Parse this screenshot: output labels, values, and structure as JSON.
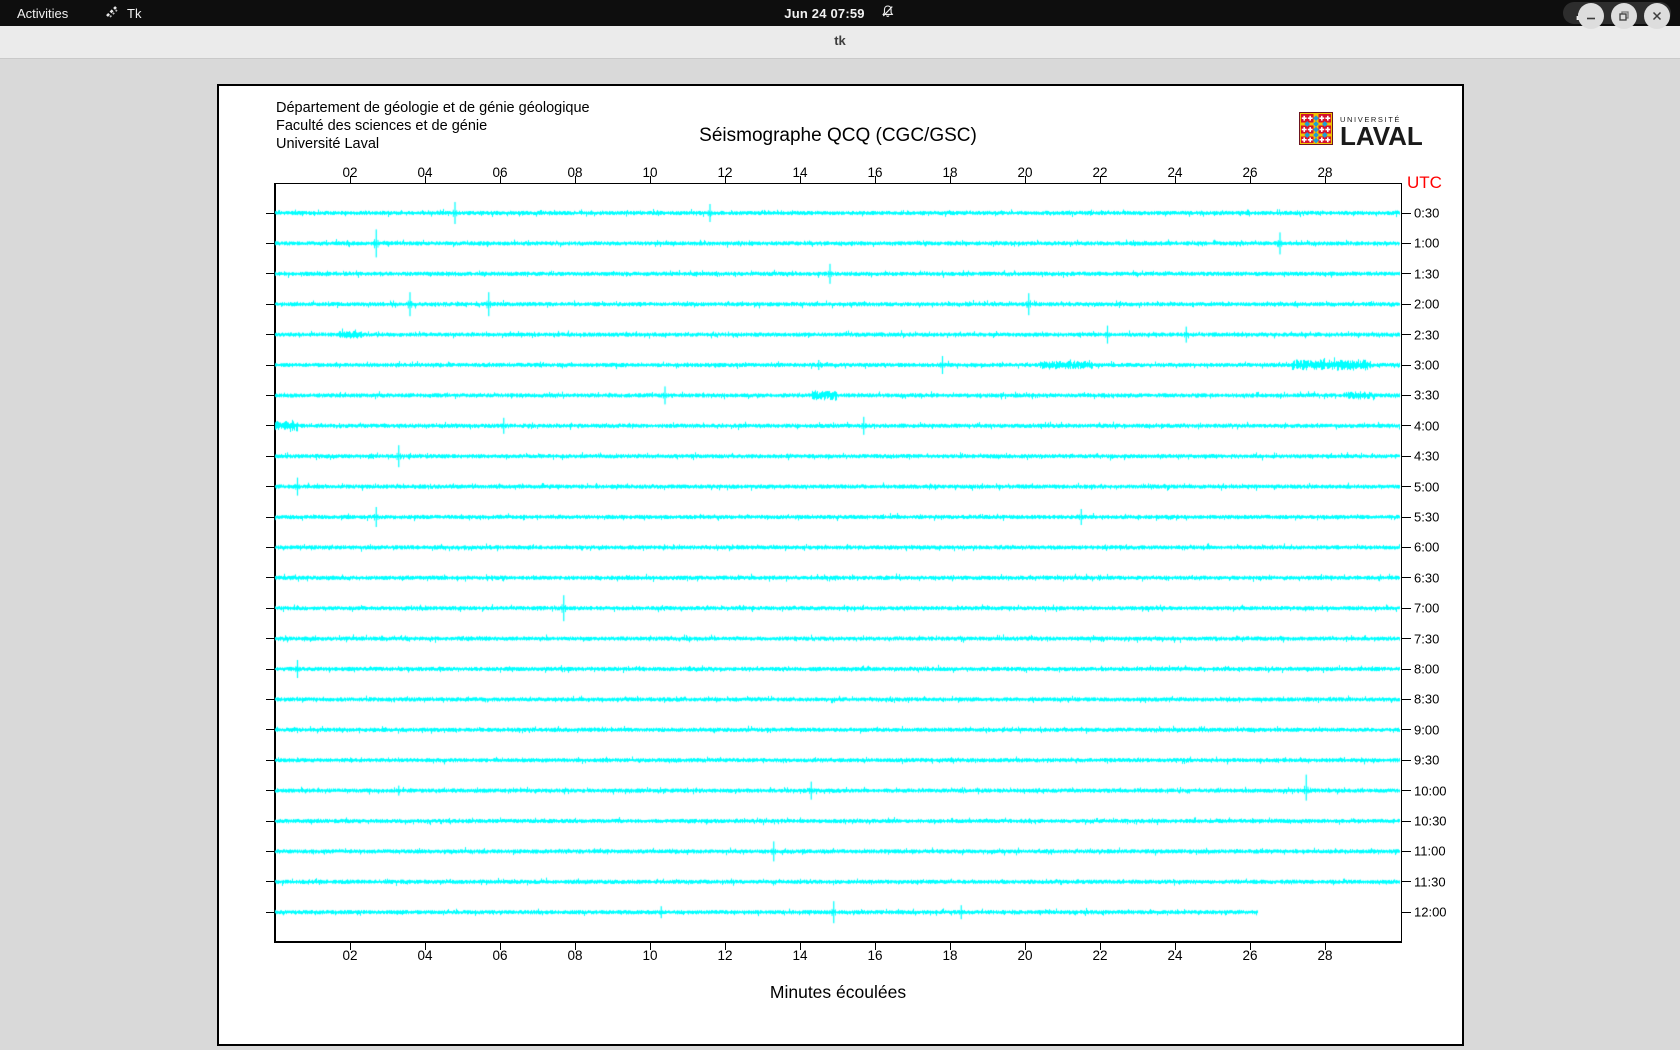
{
  "topbar": {
    "activities": "Activities",
    "app_name": "Tk",
    "clock": "Jun 24 07:59",
    "icons": [
      "tk-icon",
      "bell-slash-icon",
      "network-tree-icon",
      "volume-icon",
      "power-icon"
    ]
  },
  "titlebar": {
    "title": "tk"
  },
  "panel": {
    "header_lines": [
      "Département de géologie et de génie géologique",
      "Faculté des sciences et de génie",
      "Université Laval"
    ],
    "title": "Séismographe QCQ (CGC/GSC)",
    "logo": {
      "small": "UNIVERSITÉ",
      "large": "LAVAL"
    },
    "utc_label": "UTC",
    "xlabel": "Minutes écoulées"
  },
  "chart_data": {
    "type": "line",
    "title": "Séismographe QCQ (CGC/GSC)",
    "xlabel": "Minutes écoulées",
    "x_ticks": [
      "02",
      "04",
      "06",
      "08",
      "10",
      "12",
      "14",
      "16",
      "18",
      "20",
      "22",
      "24",
      "26",
      "28"
    ],
    "minutes_per_row": 30,
    "trace_labels": [
      "0:30",
      "1:00",
      "1:30",
      "2:00",
      "2:30",
      "3:00",
      "3:30",
      "4:00",
      "4:30",
      "5:00",
      "5:30",
      "6:00",
      "6:30",
      "7:00",
      "7:30",
      "8:00",
      "8:30",
      "9:00",
      "9:30",
      "10:00",
      "10:30",
      "11:00",
      "11:30",
      "12:00"
    ],
    "utc_label": "UTC",
    "trace_color": "#00ffff",
    "utc_color": "#ff0000",
    "last_row_end_minute": 26.2,
    "spikes": [
      [
        0,
        4.8,
        11,
        11
      ],
      [
        0,
        11.6,
        9,
        9
      ],
      [
        1,
        2.7,
        14,
        14
      ],
      [
        1,
        26.8,
        11,
        11
      ],
      [
        2,
        14.8,
        10,
        10
      ],
      [
        3,
        3.6,
        12,
        12
      ],
      [
        3,
        5.7,
        12,
        12
      ],
      [
        3,
        20.1,
        11,
        11
      ],
      [
        4,
        22.2,
        9,
        9
      ],
      [
        4,
        24.3,
        8,
        8
      ],
      [
        5,
        14.5,
        5,
        5
      ],
      [
        5,
        17.8,
        9,
        9
      ],
      [
        6,
        10.4,
        9,
        9
      ],
      [
        7,
        6.1,
        8,
        8
      ],
      [
        7,
        15.7,
        9,
        9
      ],
      [
        8,
        3.3,
        11,
        11
      ],
      [
        9,
        0.6,
        9,
        9
      ],
      [
        10,
        2.7,
        10,
        10
      ],
      [
        10,
        21.5,
        8,
        8
      ],
      [
        13,
        7.7,
        13,
        13
      ],
      [
        15,
        0.6,
        9,
        9
      ],
      [
        19,
        3.3,
        5,
        5
      ],
      [
        19,
        14.3,
        9,
        9
      ],
      [
        19,
        27.5,
        16,
        10
      ],
      [
        21,
        13.3,
        10,
        10
      ],
      [
        23,
        10.3,
        6,
        6
      ],
      [
        23,
        14.9,
        11,
        11
      ],
      [
        23,
        18.3,
        7,
        7
      ]
    ],
    "bursts": [
      [
        4,
        1.7,
        2.3,
        2.5
      ],
      [
        5,
        20.4,
        21.8,
        2.5
      ],
      [
        5,
        27.1,
        29.2,
        4
      ],
      [
        6,
        14.3,
        15.0,
        3.5
      ],
      [
        6,
        28.5,
        29.3,
        2.5
      ],
      [
        7,
        0,
        0.6,
        3.5
      ]
    ]
  }
}
